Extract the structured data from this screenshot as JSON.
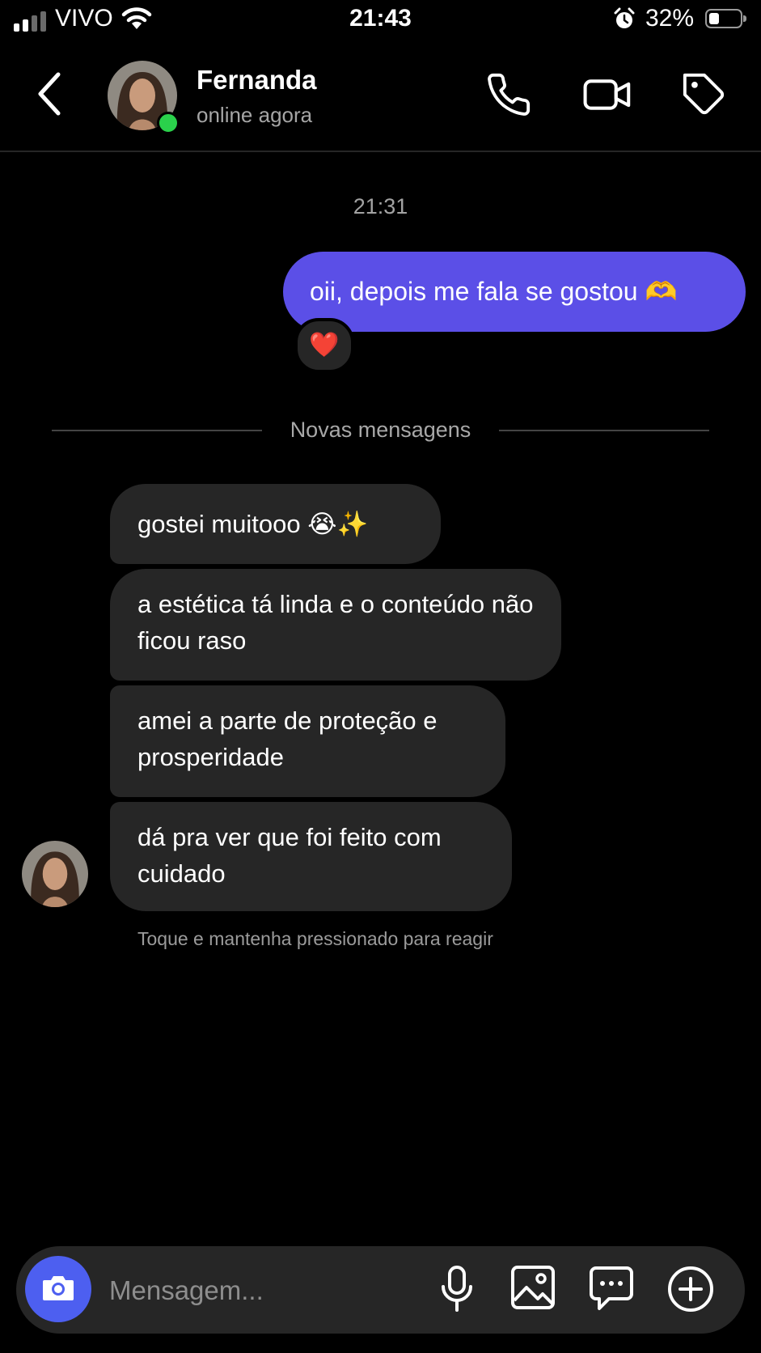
{
  "status_bar": {
    "carrier": "VIVO",
    "time": "21:43",
    "battery_percent": "32%",
    "battery_level": 0.32
  },
  "header": {
    "contact_name": "Fernanda",
    "presence": "online agora",
    "icons": [
      "back-chevron-icon",
      "phone-icon",
      "video-camera-icon",
      "tag-icon"
    ]
  },
  "chat": {
    "timestamp": "21:31",
    "sent_message": {
      "text": "oii, depois me fala se gostou 🫶",
      "reaction": "❤️"
    },
    "new_messages_divider": "Novas mensagens",
    "received_messages": [
      {
        "text": "gostei muitooo 😭✨"
      },
      {
        "text": "a estética tá linda e o conteúdo não ficou raso"
      },
      {
        "text": "amei a parte de proteção e prosperidade"
      },
      {
        "text": "dá pra ver que foi feito com cuidado"
      }
    ],
    "reaction_hint": "Toque e mantenha pressionado para reagir"
  },
  "composer": {
    "placeholder": "Mensagem...",
    "icons": [
      "camera-icon",
      "microphone-icon",
      "gallery-icon",
      "sticker-chat-icon",
      "plus-circle-icon"
    ]
  },
  "colors": {
    "sent_bubble": "#5b4fe7",
    "received_bubble": "#262626",
    "camera_button": "#4d5ff0",
    "online_dot": "#2ad14b"
  }
}
